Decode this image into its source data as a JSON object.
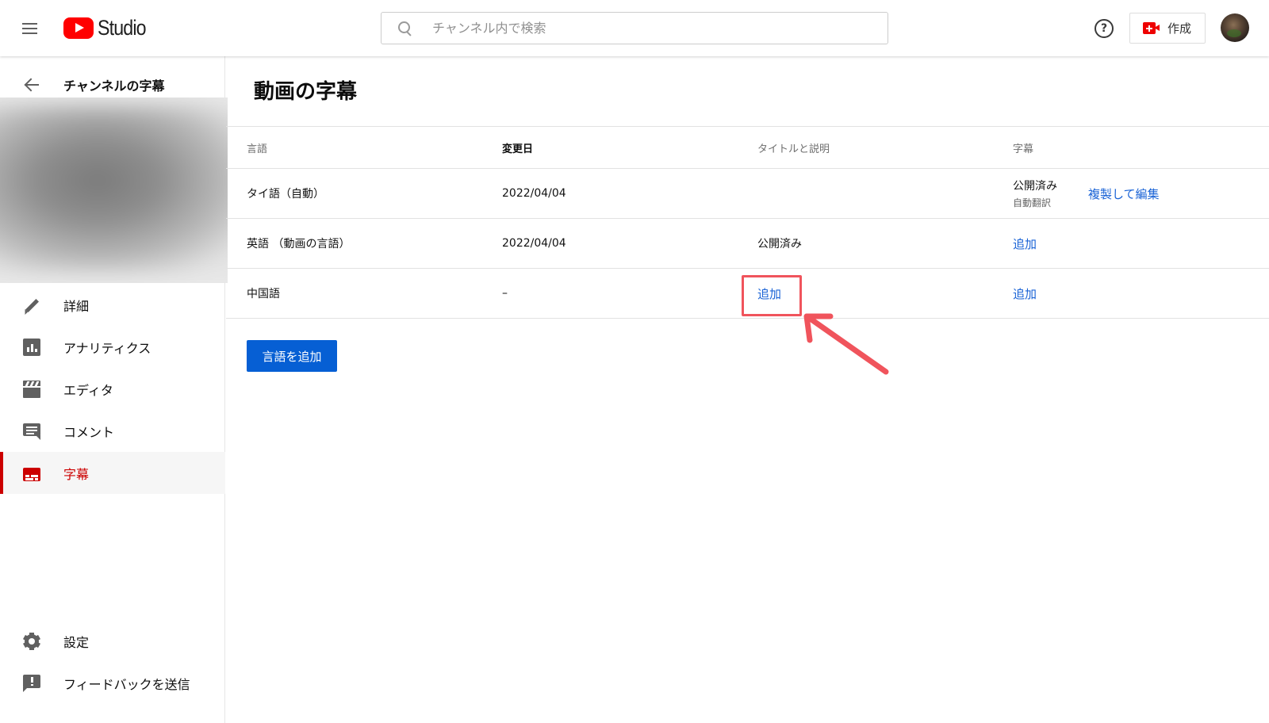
{
  "header": {
    "logo_text": "Studio",
    "search_placeholder": "チャンネル内で検索",
    "help_symbol": "?",
    "create_label": "作成"
  },
  "sidebar": {
    "back_label": "チャンネルの字幕",
    "nav": [
      {
        "label": "詳細",
        "icon": "pencil-icon",
        "active": false
      },
      {
        "label": "アナリティクス",
        "icon": "analytics-icon",
        "active": false
      },
      {
        "label": "エディタ",
        "icon": "clapperboard-icon",
        "active": false
      },
      {
        "label": "コメント",
        "icon": "comment-icon",
        "active": false
      },
      {
        "label": "字幕",
        "icon": "subtitles-icon",
        "active": true
      }
    ],
    "bottom": [
      {
        "label": "設定",
        "icon": "gear-icon"
      },
      {
        "label": "フィードバックを送信",
        "icon": "feedback-icon"
      }
    ]
  },
  "main": {
    "title": "動画の字幕",
    "columns": [
      "言語",
      "変更日",
      "タイトルと説明",
      "字幕"
    ],
    "rows": [
      {
        "language": "タイ語（自動）",
        "modified": "2022/04/04",
        "title_desc": "",
        "subtitle_status": "公開済み",
        "subtitle_sub": "自動翻訳",
        "subtitle_action": "複製して編集"
      },
      {
        "language": "英語 （動画の言語）",
        "modified": "2022/04/04",
        "title_desc": "公開済み",
        "subtitle_action": "追加"
      },
      {
        "language": "中国語",
        "modified": "–",
        "title_desc_action": "追加",
        "subtitle_action": "追加"
      }
    ],
    "add_language_button": "言語を追加"
  },
  "colors": {
    "brand_red": "#ff0000",
    "active_red": "#cc0000",
    "link_blue": "#1a63d6",
    "button_blue": "#065fd4",
    "annotation": "#f0545c"
  }
}
